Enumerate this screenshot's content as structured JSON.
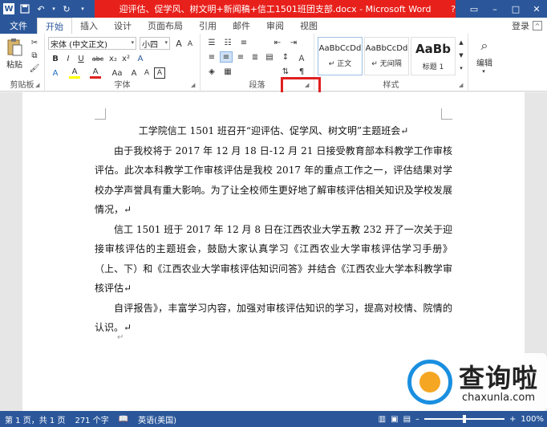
{
  "window": {
    "title": "迎评估、促学风、树文明+新闻稿+信工1501班团支部.docx - Microsoft Word",
    "controls": [
      "?",
      "▭",
      "–",
      "□",
      "✕"
    ]
  },
  "qat": {
    "app_icon_text": "W"
  },
  "tabs": {
    "items": [
      "文件",
      "开始",
      "插入",
      "设计",
      "页面布局",
      "引用",
      "邮件",
      "审阅",
      "视图"
    ],
    "login": "登录"
  },
  "ribbon": {
    "clipboard": {
      "paste_label": "粘贴",
      "group_label": "剪贴板"
    },
    "font": {
      "font_name": "宋体 (中文正文)",
      "font_size": "小四",
      "group_label": "字体",
      "buttons": [
        "B",
        "I",
        "U",
        "abc",
        "x₂",
        "x²",
        "A",
        "A",
        "A",
        "Aa",
        "A",
        "A",
        "A"
      ]
    },
    "paragraph": {
      "group_label": "段落"
    },
    "styles": {
      "group_label": "样式",
      "items": [
        {
          "preview": "AaBbCcDd",
          "name": "↵ 正文"
        },
        {
          "preview": "AaBbCcDd",
          "name": "↵ 无间隔"
        },
        {
          "preview": "AaBb",
          "name": "标题 1"
        }
      ]
    },
    "editing": {
      "label": "编辑"
    }
  },
  "document": {
    "title": "工学院信工 1501 班召开“迎评估、促学风、树文明”主题班会↵",
    "paragraphs": [
      "由于我校将于 2017 年 12 月 18 日-12 月 21 日接受教育部本科教学工作审核评估。此次本科教学工作审核评估是我校 2017 年的重点工作之一，评估结果对学校办学声誉具有重大影响。为了让全校师生更好地了解审核评估相关知识及学校发展情况，↵",
      "信工 1501 班于 2017 年 12 月 8 日在江西农业大学五教 232 开了一次关于迎接审核评估的主题班会，鼓励大家认真学习《江西农业大学审核评估学习手册》（上、下）和《江西农业大学审核评估知识问答》并结合《江西农业大学本科教学审核评估↵",
      "自评报告》，丰富学习内容，加强对审核评估知识的学习，提高对校情、院情的认识。↵"
    ],
    "trailing_mark": "↵"
  },
  "watermark": {
    "cn": "查询啦",
    "en": "chaxunla.com"
  },
  "statusbar": {
    "page": "第 1 页，共 1 页",
    "words": "271 个字",
    "lang": "英语(美国)",
    "zoom": "100%"
  }
}
